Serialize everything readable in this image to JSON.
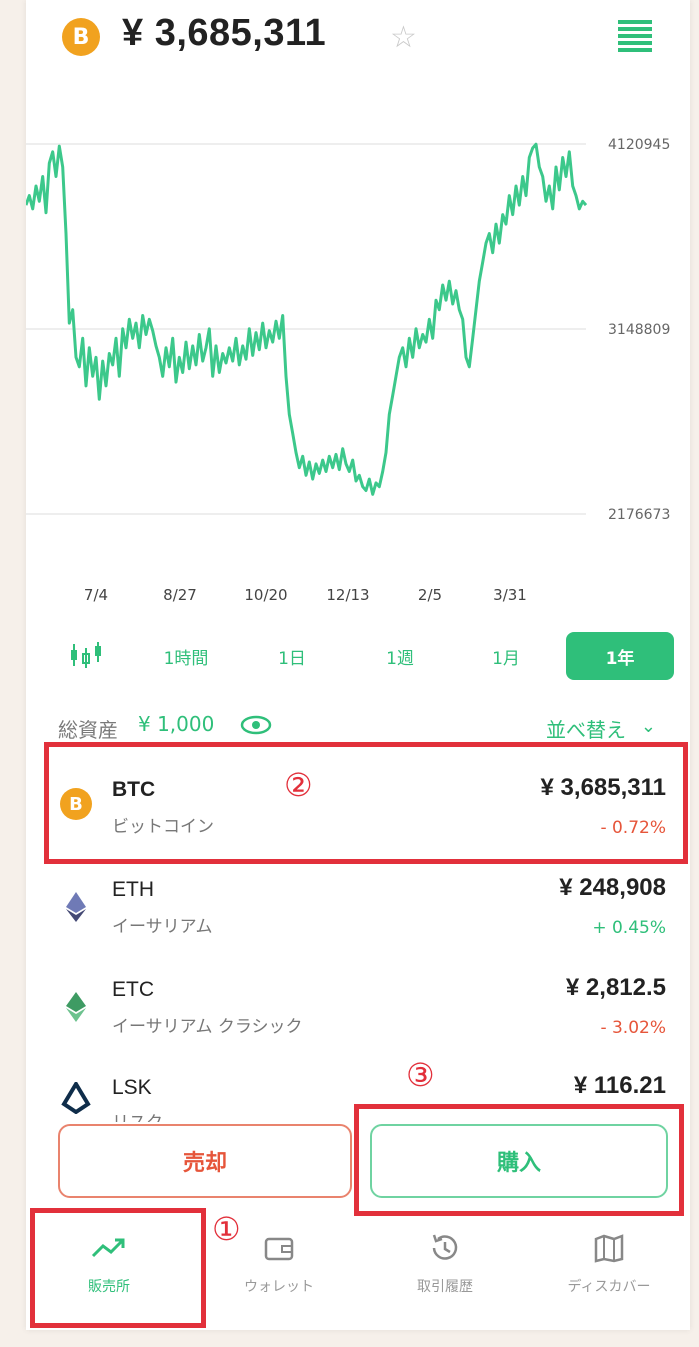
{
  "header": {
    "price": "¥ 3,685,311",
    "coin_symbol": "B"
  },
  "chart_data": {
    "type": "line",
    "y_ticks": [
      "4120945",
      "3148809",
      "2176673"
    ],
    "ylim": [
      2176673,
      4120945
    ],
    "x_ticks": [
      "7/4",
      "8/27",
      "10/20",
      "12/13",
      "2/5",
      "3/31"
    ],
    "series": [
      {
        "color": "#3cc88b",
        "values": [
          3800000,
          3850000,
          3780000,
          3900000,
          3820000,
          3950000,
          3760000,
          4020000,
          4080000,
          3950000,
          4110000,
          4000000,
          3650000,
          3180000,
          3250000,
          3000000,
          2950000,
          3100000,
          2850000,
          3050000,
          2900000,
          3000000,
          2780000,
          2980000,
          2850000,
          3020000,
          2960000,
          3100000,
          2900000,
          3150000,
          3050000,
          3200000,
          3100000,
          3180000,
          3050000,
          3220000,
          3120000,
          3200000,
          3140000,
          3060000,
          3000000,
          2900000,
          3050000,
          2950000,
          3100000,
          2870000,
          3000000,
          2920000,
          3080000,
          2940000,
          3060000,
          2960000,
          3120000,
          2980000,
          3050000,
          3150000,
          2900000,
          3060000,
          2920000,
          3020000,
          2970000,
          3050000,
          2980000,
          3100000,
          2960000,
          3060000,
          2990000,
          3150000,
          3010000,
          3130000,
          3040000,
          3180000,
          3050000,
          3140000,
          3080000,
          3190000,
          3100000,
          3220000,
          2900000,
          2700000,
          2600000,
          2500000,
          2420000,
          2480000,
          2380000,
          2450000,
          2360000,
          2440000,
          2390000,
          2460000,
          2400000,
          2480000,
          2420000,
          2490000,
          2410000,
          2520000,
          2440000,
          2400000,
          2460000,
          2350000,
          2380000,
          2320000,
          2300000,
          2360000,
          2280000,
          2340000,
          2320000,
          2400000,
          2500000,
          2700000,
          2800000,
          2900000,
          3000000,
          3050000,
          2950000,
          3100000,
          3000000,
          3150000,
          3050000,
          3120000,
          3080000,
          3200000,
          3100000,
          3300000,
          3250000,
          3380000,
          3300000,
          3400000,
          3280000,
          3350000,
          3250000,
          3200000,
          3000000,
          2950000,
          3100000,
          3250000,
          3400000,
          3500000,
          3600000,
          3650000,
          3550000,
          3700000,
          3600000,
          3750000,
          3700000,
          3850000,
          3750000,
          3900000,
          3800000,
          3950000,
          3850000,
          4050000,
          4100000,
          4120000,
          4000000,
          3950000,
          3820000,
          3900000,
          3780000,
          4000000,
          3880000,
          4050000,
          3950000,
          4080000,
          3900000,
          3850000,
          3780000,
          3820000,
          3800000
        ]
      }
    ]
  },
  "timeframes": {
    "candle_icon": "candle-icon",
    "items": [
      "1時間",
      "1日",
      "1週",
      "1月",
      "1年"
    ],
    "active": "1年"
  },
  "assets": {
    "label": "総資産",
    "value": "¥ 1,000",
    "sort_label": "並べ替え"
  },
  "coins": [
    {
      "sym": "BTC",
      "jp": "ビットコイン",
      "price": "¥ 3,685,311",
      "change": "- 0.72%",
      "dir": "neg",
      "color": "#f1a21f",
      "icon": "bitcoin-icon"
    },
    {
      "sym": "ETH",
      "jp": "イーサリアム",
      "price": "¥ 248,908",
      "change": "+ 0.45%",
      "dir": "pos",
      "color": "#6f7ab6",
      "icon": "ethereum-icon"
    },
    {
      "sym": "ETC",
      "jp": "イーサリアム クラシック",
      "price": "¥ 2,812.5",
      "change": "- 3.02%",
      "dir": "neg",
      "color": "#3e9b63",
      "icon": "ethereum-classic-icon"
    },
    {
      "sym": "LSK",
      "jp": "リスク",
      "price": "¥ 116.21",
      "change": "",
      "dir": "neg",
      "color": "#0f2d4a",
      "icon": "lisk-icon"
    }
  ],
  "actions": {
    "sell": "売却",
    "buy": "購入"
  },
  "nav": [
    {
      "label": "販売所",
      "icon": "trend-icon",
      "active": true
    },
    {
      "label": "ウォレット",
      "icon": "wallet-icon",
      "active": false
    },
    {
      "label": "取引履歴",
      "icon": "history-icon",
      "active": false
    },
    {
      "label": "ディスカバー",
      "icon": "map-icon",
      "active": false
    }
  ],
  "annotations": {
    "one": "①",
    "two": "②",
    "three": "③"
  }
}
